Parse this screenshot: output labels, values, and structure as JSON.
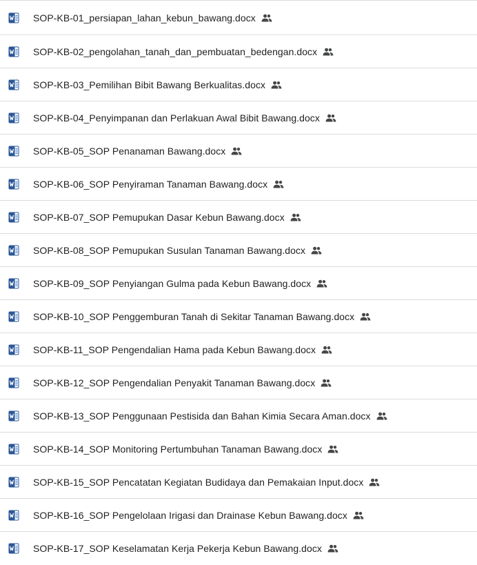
{
  "colors": {
    "text": "#1f1f1f",
    "divider": "#dadce0",
    "word_icon_blue": "#2b5797",
    "word_icon_light": "#4a86d8",
    "shared_icon": "#444746"
  },
  "icons": {
    "file_type": "word-document-icon",
    "status": "shared-people-icon"
  },
  "files": [
    {
      "name": "SOP-KB-01_persiapan_lahan_kebun_bawang.docx",
      "shared": true
    },
    {
      "name": "SOP-KB-02_pengolahan_tanah_dan_pembuatan_bedengan.docx",
      "shared": true
    },
    {
      "name": "SOP-KB-03_Pemilihan Bibit Bawang Berkualitas.docx",
      "shared": true
    },
    {
      "name": "SOP-KB-04_Penyimpanan dan Perlakuan Awal Bibit Bawang.docx",
      "shared": true
    },
    {
      "name": "SOP-KB-05_SOP Penanaman Bawang.docx",
      "shared": true
    },
    {
      "name": "SOP-KB-06_SOP Penyiraman Tanaman Bawang.docx",
      "shared": true
    },
    {
      "name": "SOP-KB-07_SOP Pemupukan Dasar Kebun Bawang.docx",
      "shared": true
    },
    {
      "name": "SOP-KB-08_SOP Pemupukan Susulan Tanaman Bawang.docx",
      "shared": true
    },
    {
      "name": "SOP-KB-09_SOP Penyiangan Gulma pada Kebun Bawang.docx",
      "shared": true
    },
    {
      "name": "SOP-KB-10_SOP Penggemburan Tanah di Sekitar Tanaman Bawang.docx",
      "shared": true
    },
    {
      "name": "SOP-KB-11_SOP Pengendalian Hama pada Kebun Bawang.docx",
      "shared": true
    },
    {
      "name": "SOP-KB-12_SOP Pengendalian Penyakit Tanaman Bawang.docx",
      "shared": true
    },
    {
      "name": "SOP-KB-13_SOP Penggunaan Pestisida dan Bahan Kimia Secara Aman.docx",
      "shared": true
    },
    {
      "name": "SOP-KB-14_SOP Monitoring Pertumbuhan Tanaman Bawang.docx",
      "shared": true
    },
    {
      "name": "SOP-KB-15_SOP Pencatatan Kegiatan Budidaya dan Pemakaian Input.docx",
      "shared": true
    },
    {
      "name": "SOP-KB-16_SOP Pengelolaan Irigasi dan Drainase Kebun Bawang.docx",
      "shared": true
    },
    {
      "name": "SOP-KB-17_SOP Keselamatan Kerja Pekerja Kebun Bawang.docx",
      "shared": true
    }
  ]
}
